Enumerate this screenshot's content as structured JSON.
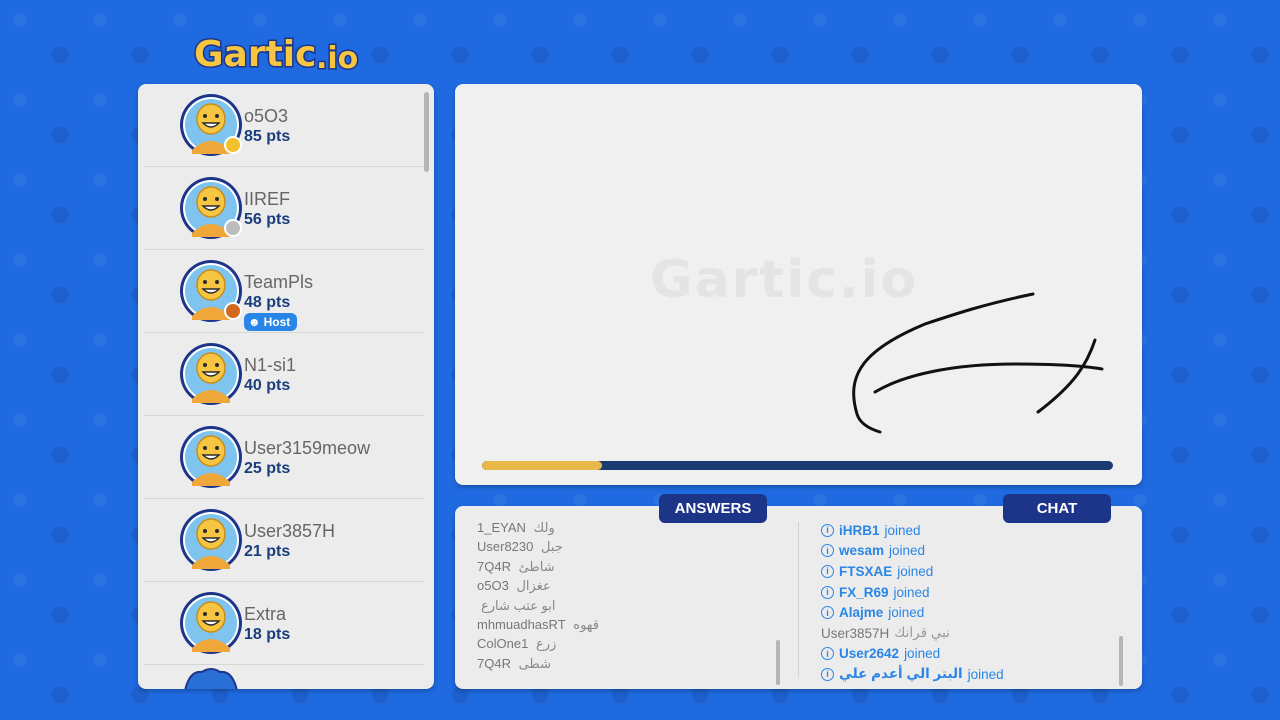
{
  "app": {
    "logo_text": "Gartic.io",
    "watermark_text": "Gartic.io"
  },
  "players": [
    {
      "name": "o5O3",
      "points": "85 pts",
      "rank_color": "#f2c22e"
    },
    {
      "name": "IIREF",
      "points": "56 pts",
      "rank_color": "#bdbdbd"
    },
    {
      "name": "TeamPls",
      "points": "48 pts",
      "rank_color": "#d2691e",
      "badge": "Host"
    },
    {
      "name": "N1-si1",
      "points": "40 pts"
    },
    {
      "name": "User3159meow",
      "points": "25 pts"
    },
    {
      "name": "User3857H",
      "points": "21 pts"
    },
    {
      "name": "Extra",
      "points": "18 pts"
    }
  ],
  "timer": {
    "progress_percent": 19
  },
  "tabs": {
    "answers": "ANSWERS",
    "chat": "CHAT"
  },
  "answers": [
    {
      "user": "1_EYAN",
      "text": "ولك"
    },
    {
      "user": "User8230",
      "text": "جبل"
    },
    {
      "user": "7Q4R",
      "text": "شاطئ"
    },
    {
      "user": "o5O3",
      "text": "عغزال"
    },
    {
      "user": "",
      "text": "ابو عتب شارع"
    },
    {
      "user": "mhmuadhasRT",
      "text": "قهوه"
    },
    {
      "user": "ColOne1",
      "text": "زرع"
    },
    {
      "user": "7Q4R",
      "text": "شطى"
    }
  ],
  "chat": [
    {
      "type": "join",
      "user": "iHRB1",
      "text": "joined"
    },
    {
      "type": "join",
      "user": "wesam",
      "text": "joined"
    },
    {
      "type": "join",
      "user": "FTSXAE",
      "text": "joined"
    },
    {
      "type": "join",
      "user": "FX_R69",
      "text": "joined"
    },
    {
      "type": "join",
      "user": "Alajme",
      "text": "joined"
    },
    {
      "type": "guess",
      "user": "User3857H",
      "text": "نبي قرانك"
    },
    {
      "type": "join",
      "user": "User2642",
      "text": "joined"
    },
    {
      "type": "join",
      "user": "البتر الي أعدم علي",
      "text": "joined"
    }
  ],
  "colors": {
    "background": "#1f6ae0",
    "panel": "#ececec",
    "tab": "#1d3589",
    "accent": "#2a86e6",
    "timer_fill": "#e8b94a",
    "timer_track": "#1d3b73"
  },
  "icons": {
    "info": "info-circle-icon",
    "host": "crown-smile-icon",
    "avatar": "smiley-avatar-icon"
  }
}
